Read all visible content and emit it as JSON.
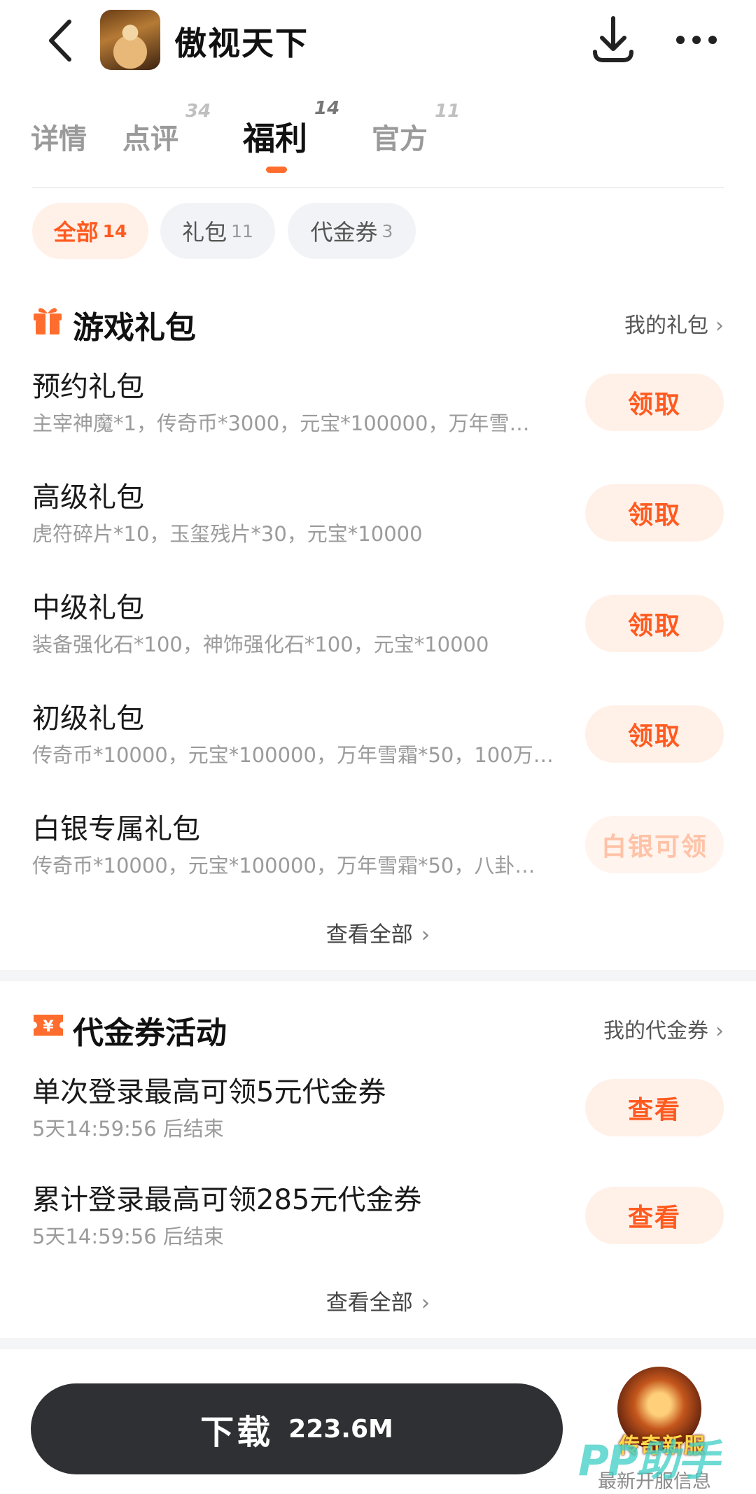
{
  "header": {
    "title": "傲视天下"
  },
  "tabs": [
    {
      "label": "详情",
      "count": ""
    },
    {
      "label": "点评",
      "count": "34"
    },
    {
      "label": "福利",
      "count": "14"
    },
    {
      "label": "官方",
      "count": "11"
    }
  ],
  "filters": [
    {
      "label": "全部",
      "count": "14"
    },
    {
      "label": "礼包",
      "count": "11"
    },
    {
      "label": "代金券",
      "count": "3"
    }
  ],
  "gifts": {
    "title": "游戏礼包",
    "link": "我的礼包",
    "items": [
      {
        "name": "预约礼包",
        "desc": "主宰神魔*1，传奇币*3000，元宝*100000，万年雪…",
        "button": "领取"
      },
      {
        "name": "高级礼包",
        "desc": "虎符碎片*10，玉玺残片*30，元宝*10000",
        "button": "领取"
      },
      {
        "name": "中级礼包",
        "desc": "装备强化石*100，神饰强化石*100，元宝*10000",
        "button": "领取"
      },
      {
        "name": "初级礼包",
        "desc": "传奇币*10000，元宝*100000，万年雪霜*50，100万…",
        "button": "领取"
      },
      {
        "name": "白银专属礼包",
        "desc": "传奇币*10000，元宝*100000，万年雪霜*50，八卦…",
        "button": "白银可领"
      }
    ],
    "view_all": "查看全部"
  },
  "vouchers": {
    "title": "代金券活动",
    "link": "我的代金券",
    "items": [
      {
        "name": "单次登录最高可领5元代金券",
        "desc": "5天14:59:56 后结束",
        "button": "查看"
      },
      {
        "name": "累计登录最高可领285元代金券",
        "desc": "5天14:59:56 后结束",
        "button": "查看"
      }
    ],
    "view_all": "查看全部"
  },
  "bottom": {
    "download_label": "下载",
    "download_size": "223.6M",
    "promo_title": "传奇新服",
    "promo_sub": "最新开服信息",
    "watermark": "PP助手"
  },
  "colors": {
    "accent": "#ff5a1f",
    "accent_bg": "#fff0e8",
    "download_bg": "#2f3033"
  }
}
